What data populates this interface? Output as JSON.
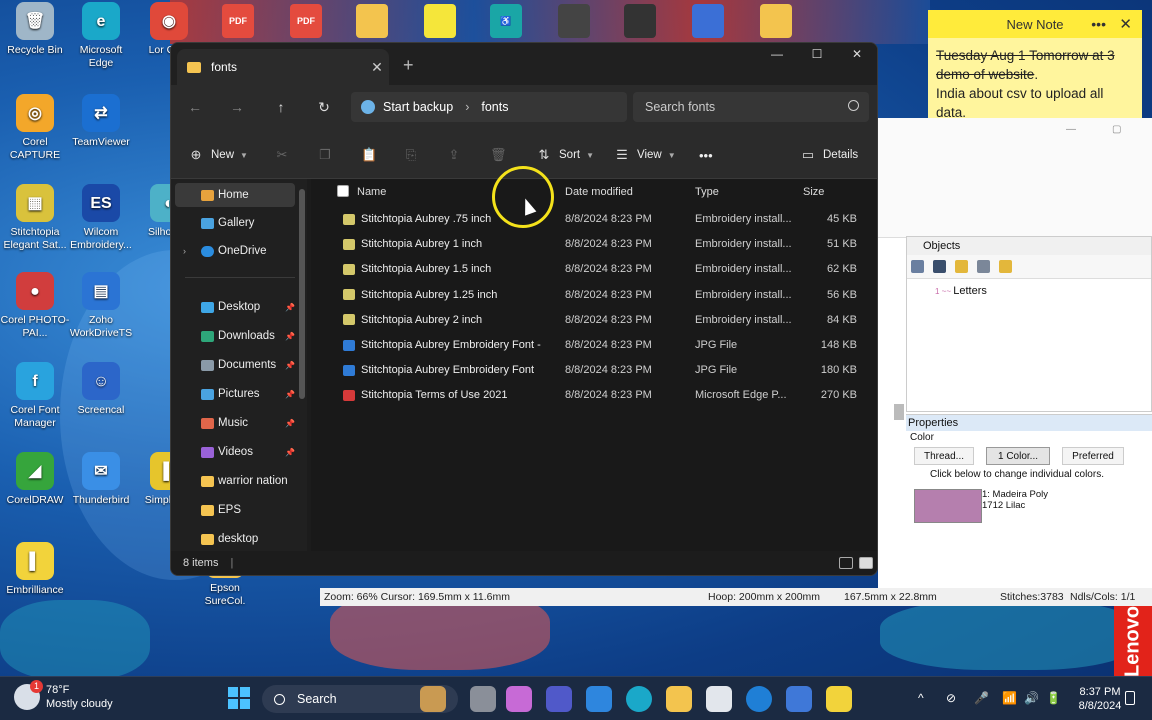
{
  "desktop": {
    "icons": [
      {
        "label": "Recycle Bin",
        "color": "#9fb6c8",
        "glyph": "🗑"
      },
      {
        "label": "Microsoft Edge",
        "color": "#1aa8c9",
        "glyph": "e"
      },
      {
        "label": "Lor Chro",
        "color": "#e0493a",
        "glyph": "◉"
      },
      {
        "label": "Corel CAPTURE",
        "color": "#f3a72a",
        "glyph": "◎"
      },
      {
        "label": "TeamViewer",
        "color": "#1b6fd1",
        "glyph": "⇄"
      },
      {
        "label": "Stitchtopia Elegant Sat...",
        "color": "#d9c23c",
        "glyph": "▦"
      },
      {
        "label": "Wilcom Embroidery...",
        "color": "#1a49a7",
        "glyph": "ES"
      },
      {
        "label": "Silho Stu",
        "color": "#4db1c8",
        "glyph": "◐"
      },
      {
        "label": "Corel PHOTO-PAI...",
        "color": "#d13d3d",
        "glyph": "●"
      },
      {
        "label": "Zoho WorkDriveTS",
        "color": "#2b74d4",
        "glyph": "▤"
      },
      {
        "label": "Corel Font Manager",
        "color": "#29a3de",
        "glyph": "f"
      },
      {
        "label": "Screencal",
        "color": "#2c66c9",
        "glyph": "☺"
      },
      {
        "label": "CorelDRAW",
        "color": "#36a53c",
        "glyph": "◢"
      },
      {
        "label": "Thunderbird",
        "color": "#3a8fe6",
        "glyph": "✉"
      },
      {
        "label": "Simple No",
        "color": "#e6c52c",
        "glyph": "▌"
      },
      {
        "label": "Embrilliance",
        "color": "#f2d33b",
        "glyph": "▌"
      },
      {
        "label": "Epson SureCol.",
        "color": "#f3c44e",
        "glyph": "▭"
      }
    ],
    "top_tiles": [
      "PDF",
      "PDF",
      "",
      "",
      "♿",
      "",
      "",
      "",
      ""
    ]
  },
  "explorer": {
    "tab_title": "fonts",
    "window_controls": [
      "—",
      "☐",
      "✕"
    ],
    "breadcrumb": {
      "root": "Start backup",
      "current": "fonts"
    },
    "search_placeholder": "Search fonts",
    "commands": {
      "new": "New",
      "sort": "Sort",
      "view": "View",
      "more": "•••",
      "details": "Details"
    },
    "nav": {
      "home": "Home",
      "gallery": "Gallery",
      "onedrive": "OneDrive",
      "quick": [
        {
          "label": "Desktop",
          "color": "#3ea6e6",
          "pinned": true
        },
        {
          "label": "Downloads",
          "color": "#2ea77a",
          "pinned": true
        },
        {
          "label": "Documents",
          "color": "#8a9aa8",
          "pinned": true
        },
        {
          "label": "Pictures",
          "color": "#4aa3e0",
          "pinned": true
        },
        {
          "label": "Music",
          "color": "#e0664a",
          "pinned": true
        },
        {
          "label": "Videos",
          "color": "#9a62d8",
          "pinned": true
        },
        {
          "label": "warrior nation",
          "color": "#f5c451",
          "pinned": false
        },
        {
          "label": "EPS",
          "color": "#f5c451",
          "pinned": false
        },
        {
          "label": "desktop",
          "color": "#f5c451",
          "pinned": false
        }
      ],
      "pin_glyph": "📌"
    },
    "columns": {
      "name": "Name",
      "date": "Date modified",
      "type": "Type",
      "size": "Size"
    },
    "files": [
      {
        "name": "Stitchtopia Aubrey .75 inch",
        "date": "8/8/2024 8:23 PM",
        "type": "Embroidery install...",
        "size": "45 KB",
        "kind": "emb"
      },
      {
        "name": "Stitchtopia Aubrey 1 inch",
        "date": "8/8/2024 8:23 PM",
        "type": "Embroidery install...",
        "size": "51 KB",
        "kind": "emb"
      },
      {
        "name": "Stitchtopia Aubrey 1.5 inch",
        "date": "8/8/2024 8:23 PM",
        "type": "Embroidery install...",
        "size": "62 KB",
        "kind": "emb"
      },
      {
        "name": "Stitchtopia Aubrey 1.25 inch",
        "date": "8/8/2024 8:23 PM",
        "type": "Embroidery install...",
        "size": "56 KB",
        "kind": "emb"
      },
      {
        "name": "Stitchtopia Aubrey 2 inch",
        "date": "8/8/2024 8:23 PM",
        "type": "Embroidery install...",
        "size": "84 KB",
        "kind": "emb"
      },
      {
        "name": "Stitchtopia Aubrey Embroidery Font - ...",
        "date": "8/8/2024 8:23 PM",
        "type": "JPG File",
        "size": "148 KB",
        "kind": "jpg"
      },
      {
        "name": "Stitchtopia Aubrey Embroidery Font",
        "date": "8/8/2024 8:23 PM",
        "type": "JPG File",
        "size": "180 KB",
        "kind": "jpg"
      },
      {
        "name": "Stitchtopia Terms of Use 2021",
        "date": "8/8/2024 8:23 PM",
        "type": "Microsoft Edge P...",
        "size": "270 KB",
        "kind": "pdf"
      }
    ],
    "status": "8 items"
  },
  "sticky_note": {
    "title": "New Note",
    "more": "•••",
    "close": "✕",
    "line_struck": "Tuesday Aug 1 Tomorrow at 3 demo of website",
    "line_struck_tail": ".",
    "line2": "India about csv to upload all data."
  },
  "embroidery_app": {
    "objects_title": "Objects",
    "objects_item": "Letters",
    "properties_title": "Properties",
    "properties_sub": "Color",
    "buttons": [
      "Thread...",
      "1 Color...",
      "Preferred"
    ],
    "hint": "Click below to change individual colors.",
    "swatch_color": "#b57fae",
    "thread_line1": "1: Madeira Poly",
    "thread_line2": "1712 Lilac",
    "status": {
      "zoom": "Zoom: 66%  Cursor: 169.5mm x 11.6mm",
      "hoop": "Hoop: 200mm x 200mm",
      "size": "167.5mm x 22.8mm",
      "stitches": "Stitches:3783",
      "ndls": "Ndls/Cols: 1/1"
    }
  },
  "taskbar": {
    "weather_temp": "78°F",
    "weather_desc": "Mostly cloudy",
    "weather_badge": "1",
    "search": "Search",
    "time": "8:37 PM",
    "date": "8/8/2024",
    "tray_icons": [
      "^",
      "⊘",
      "🎤",
      "📶",
      "🔊",
      "🔋"
    ]
  },
  "brand": "Lenovo"
}
